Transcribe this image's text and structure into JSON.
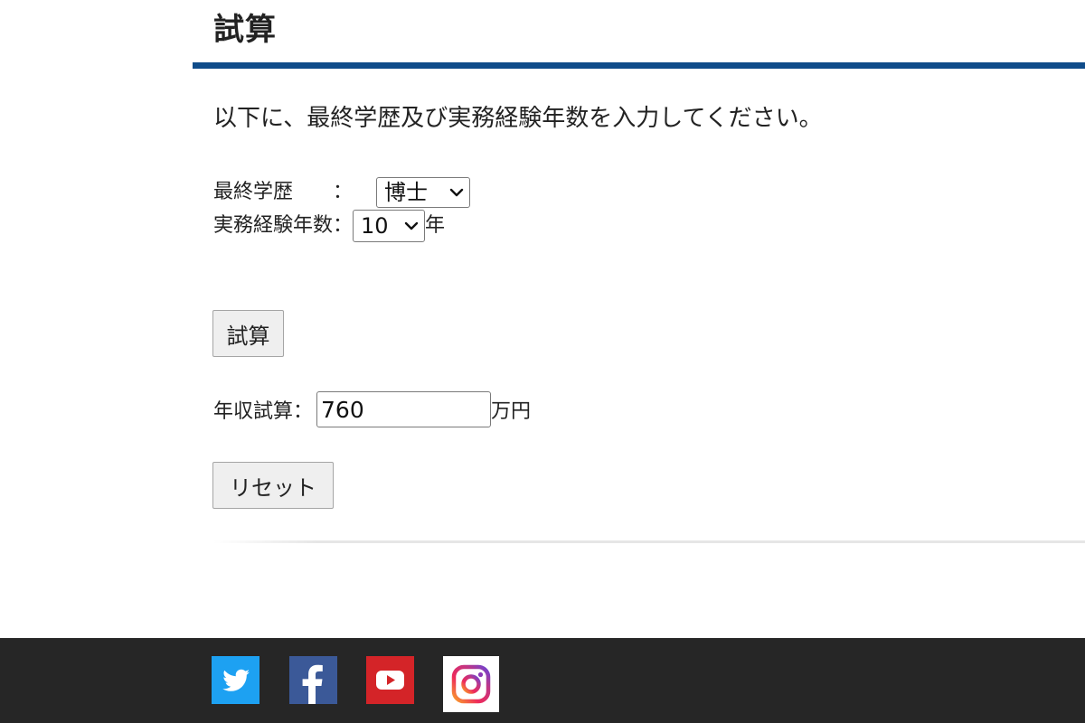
{
  "page": {
    "title": "試算",
    "instruction": "以下に、最終学歴及び実務経験年数を入力してください。"
  },
  "form": {
    "education_label": "最終学歴　　：",
    "education_value": "博士",
    "years_label": "実務経験年数：",
    "years_value": "10",
    "years_unit": "年",
    "calc_button": "試算",
    "result_label": "年収試算：",
    "result_value": "760",
    "result_unit": "万円",
    "reset_button": "リセット"
  },
  "footer": {
    "social": [
      {
        "name": "twitter",
        "icon": "twitter-icon",
        "color": "#1da1f2"
      },
      {
        "name": "facebook",
        "icon": "facebook-icon",
        "color": "#3b5998"
      },
      {
        "name": "youtube",
        "icon": "youtube-icon",
        "color": "#d42428"
      },
      {
        "name": "instagram",
        "icon": "instagram-icon",
        "color": "#ffffff"
      }
    ]
  },
  "colors": {
    "title_rule": "#0f4c8a",
    "footer_bg": "#262626"
  }
}
